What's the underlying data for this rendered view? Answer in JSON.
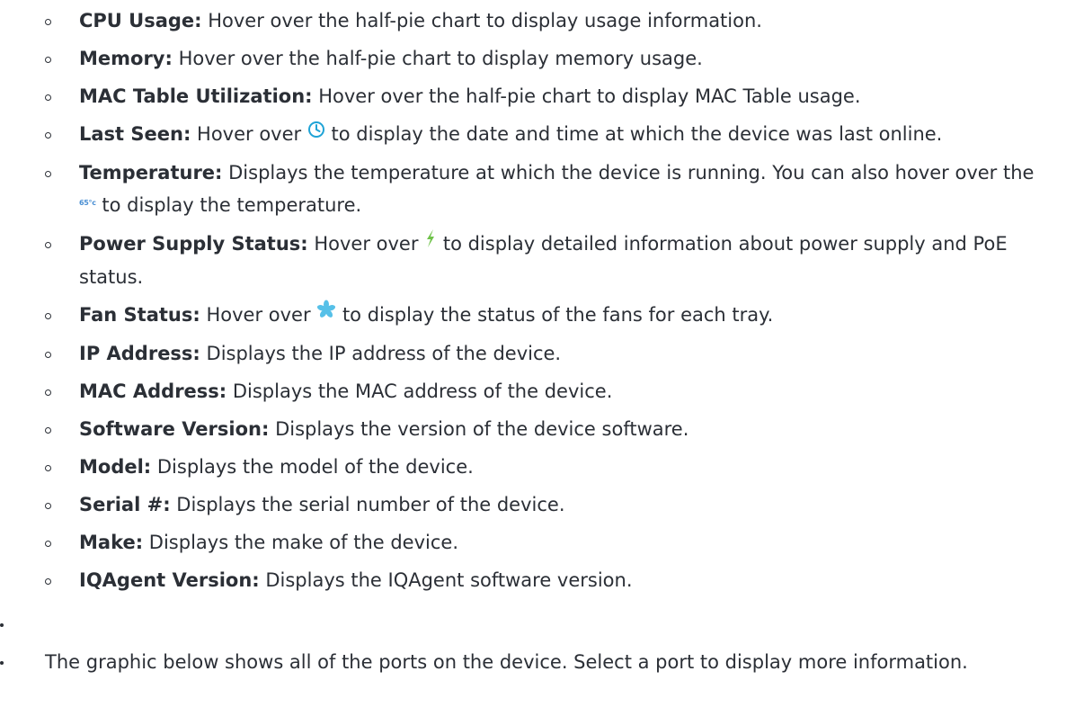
{
  "items": [
    {
      "term": "CPU Usage:",
      "pre": " Hover over the half-pie chart to display usage information.",
      "icon": null,
      "post": ""
    },
    {
      "term": "Memory:",
      "pre": " Hover over the half-pie chart to display memory usage.",
      "icon": null,
      "post": ""
    },
    {
      "term": "MAC Table Utilization:",
      "pre": " Hover over the half-pie chart to display MAC Table usage.",
      "icon": null,
      "post": ""
    },
    {
      "term": "Last Seen:",
      "pre": " Hover over ",
      "icon": "clock-icon",
      "post": " to display the date and time at which the device was last online."
    },
    {
      "term": "Temperature:",
      "pre": " Displays the temperature at which the device is running. You can also hover over the ",
      "icon": "temperature-icon",
      "icon_text": "65°c",
      "post": " to display the temperature."
    },
    {
      "term": "Power Supply Status:",
      "pre": " Hover over ",
      "icon": "lightning-icon",
      "post": " to display detailed information about power supply and PoE status."
    },
    {
      "term": "Fan Status:",
      "pre": " Hover over ",
      "icon": "fan-icon",
      "post": " to display the status of the fans for each tray."
    },
    {
      "term": "IP Address:",
      "pre": " Displays the IP address of the device.",
      "icon": null,
      "post": ""
    },
    {
      "term": "MAC Address:",
      "pre": " Displays the MAC address of the device.",
      "icon": null,
      "post": ""
    },
    {
      "term": "Software Version:",
      "pre": " Displays the version of the device software.",
      "icon": null,
      "post": ""
    },
    {
      "term": "Model:",
      "pre": " Displays the model of the device.",
      "icon": null,
      "post": ""
    },
    {
      "term": "Serial #:",
      "pre": " Displays the serial number of the device.",
      "icon": null,
      "post": ""
    },
    {
      "term": "Make:",
      "pre": " Displays the make of the device.",
      "icon": null,
      "post": ""
    },
    {
      "term": "IQAgent Version:",
      "pre": " Displays the IQAgent software version.",
      "icon": null,
      "post": ""
    }
  ],
  "outer": {
    "empty": "",
    "ports_text": "The graphic below shows all of the ports on the device. Select a port to display more information."
  },
  "colors": {
    "text": "#2b2f36",
    "clock_icon": "#1fa3d6",
    "lightning_icon": "#6fc24a",
    "fan_icon": "#56c0e8",
    "temperature_icon": "#4a8fd3"
  }
}
